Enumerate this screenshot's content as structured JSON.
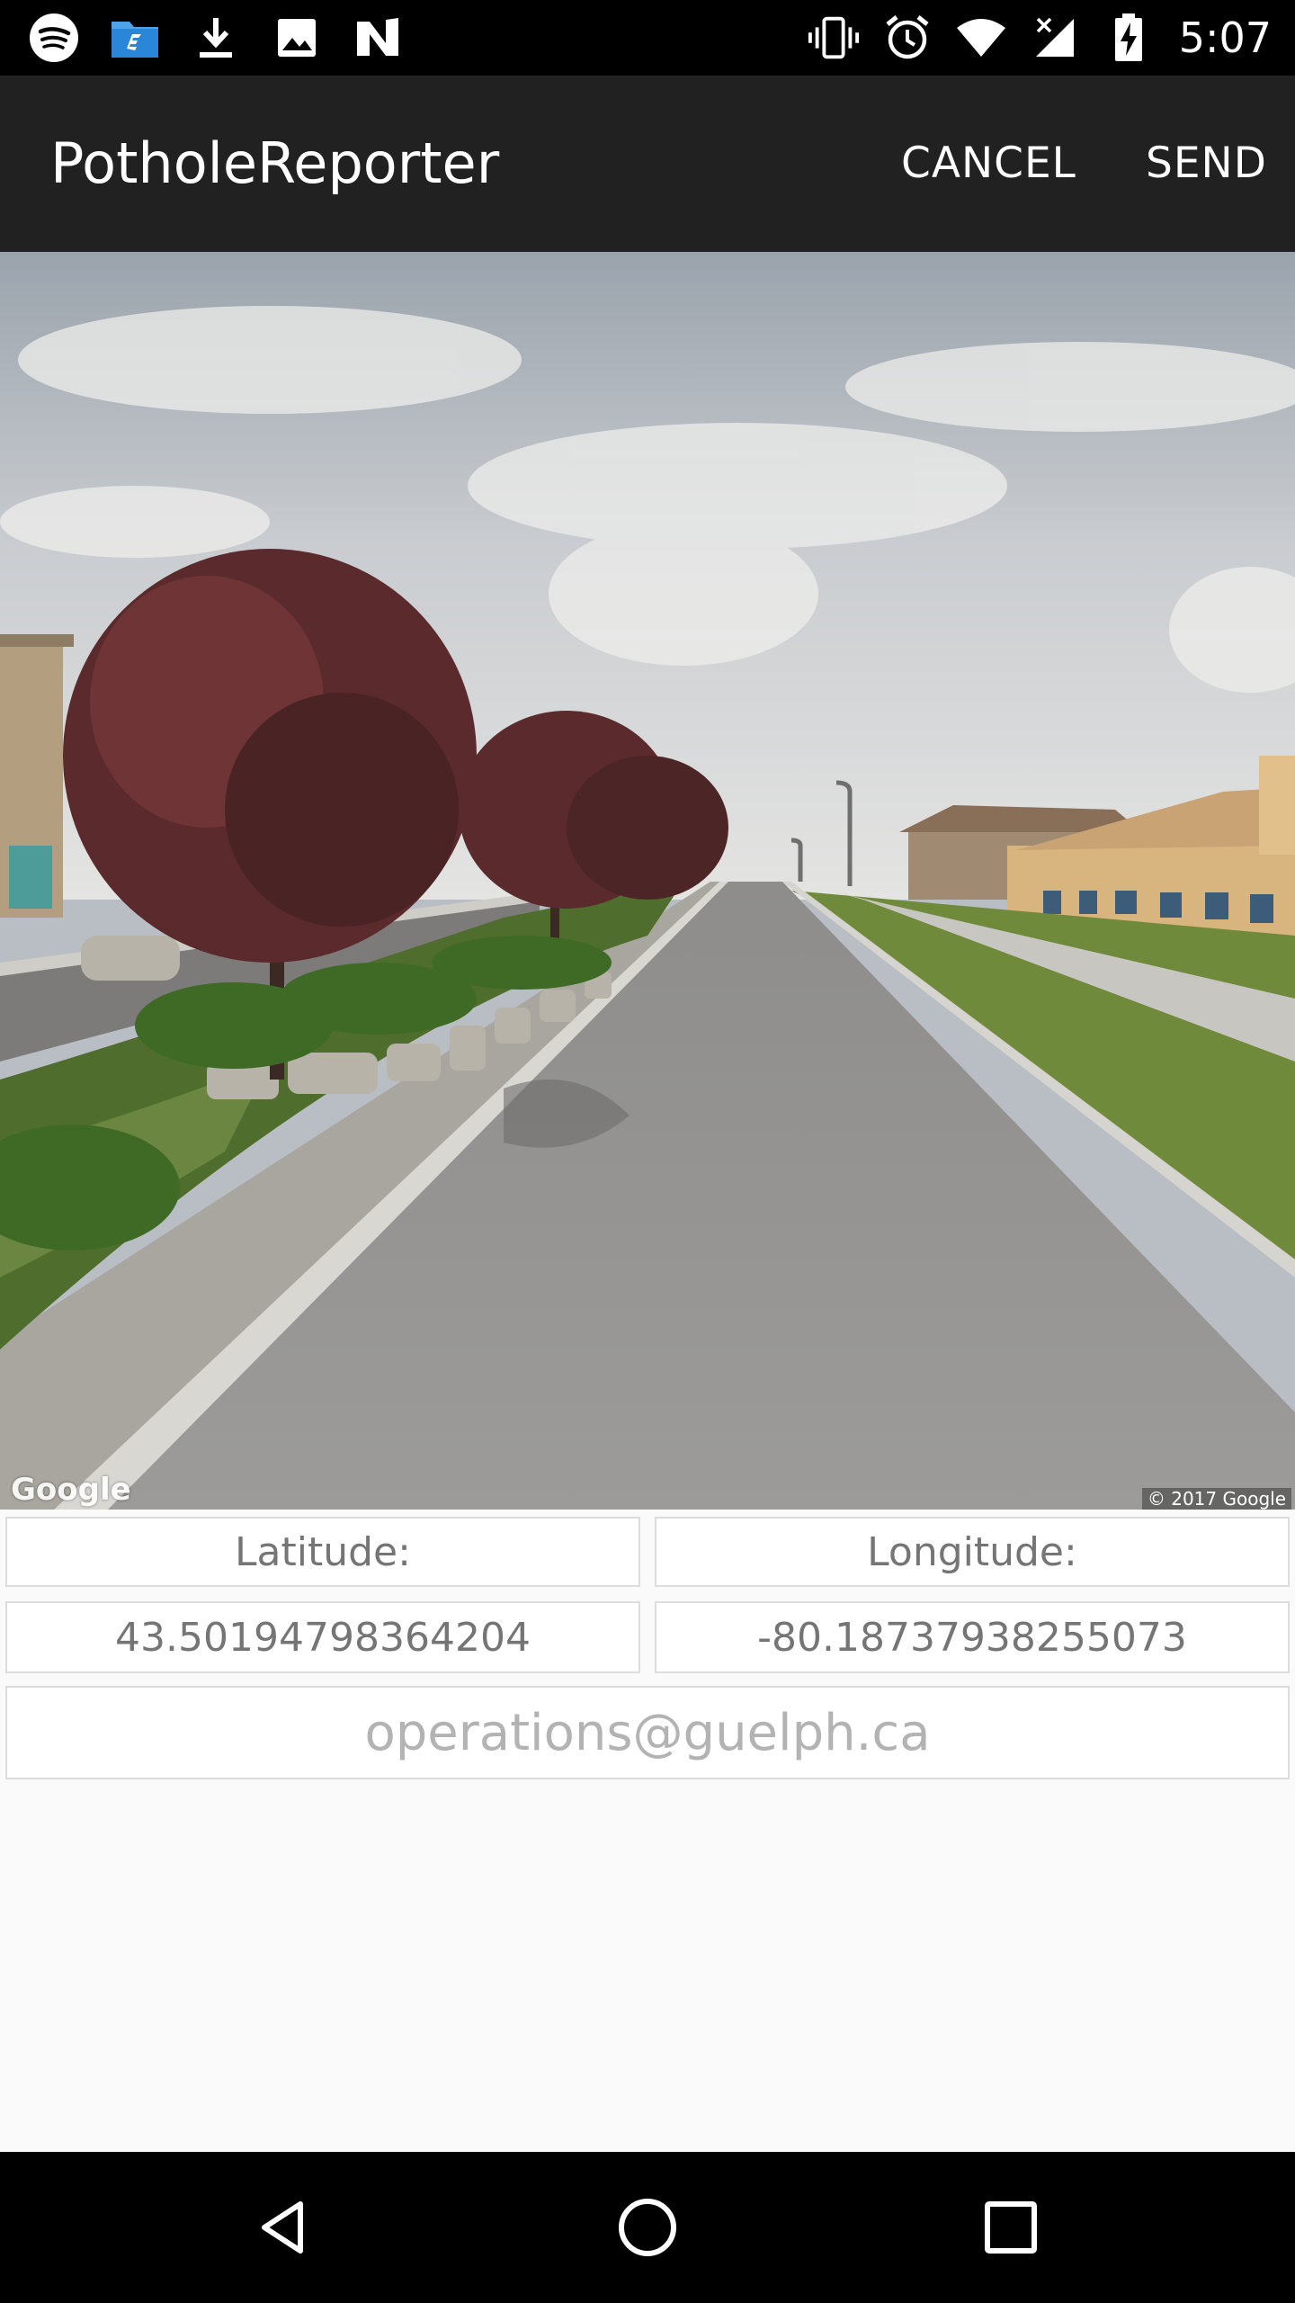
{
  "status_bar": {
    "time": "5:07",
    "left_icons": [
      "spotify-icon",
      "file-manager-icon",
      "download-icon",
      "image-icon",
      "n-app-icon"
    ],
    "right_icons": [
      "vibrate-icon",
      "alarm-icon",
      "wifi-icon",
      "cell-signal-icon",
      "battery-charging-icon"
    ]
  },
  "app_bar": {
    "title": "PotholeReporter",
    "cancel_label": "CANCEL",
    "send_label": "SEND"
  },
  "street_view": {
    "watermark": "Google",
    "copyright": "© 2017 Google"
  },
  "form": {
    "latitude_label": "Latitude:",
    "longitude_label": "Longitude:",
    "latitude_value": "43.50194798364204",
    "longitude_value": "-80.18737938255073",
    "email_placeholder": "operations@guelph.ca",
    "email_value": ""
  },
  "nav_bar": {
    "buttons": [
      "back-icon",
      "home-icon",
      "recents-icon"
    ]
  },
  "colors": {
    "status_bar": "#000000",
    "app_bar": "#212121",
    "background": "#fafafa",
    "field_text": "#757575",
    "placeholder": "#b3b3b3"
  }
}
